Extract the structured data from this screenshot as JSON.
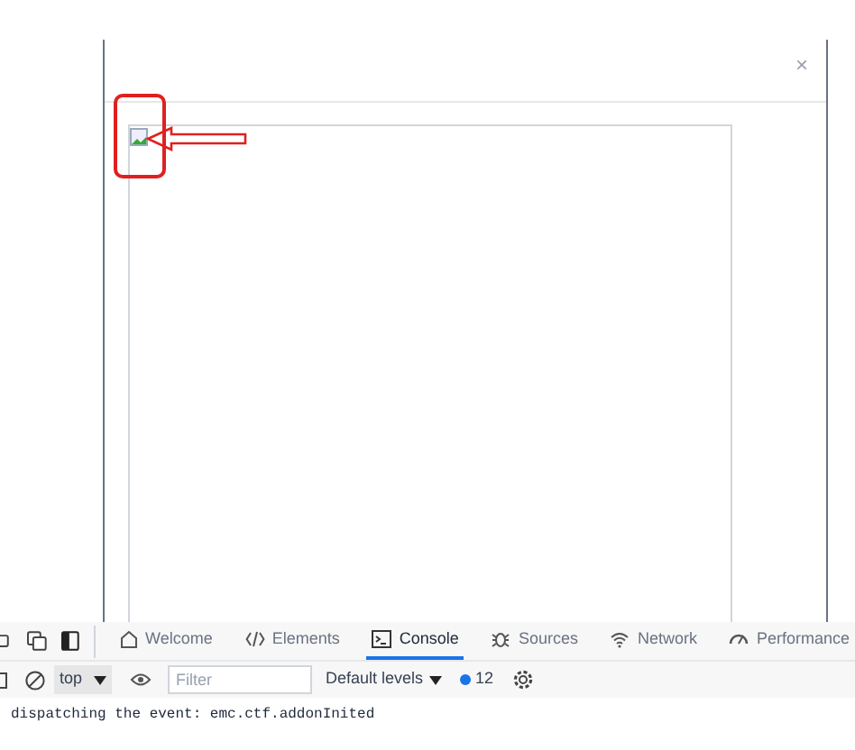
{
  "dialog": {
    "close": "×"
  },
  "devtools": {
    "tabs": [
      {
        "label": "Welcome",
        "selected": false
      },
      {
        "label": "Elements",
        "selected": false
      },
      {
        "label": "Console",
        "selected": true
      },
      {
        "label": "Sources",
        "selected": false
      },
      {
        "label": "Network",
        "selected": false
      },
      {
        "label": "Performance",
        "selected": false
      }
    ],
    "toolbar": {
      "context": "top",
      "filter": {
        "placeholder": "Filter"
      },
      "levels": "Default levels",
      "issues": "12"
    },
    "console": [
      "dispatching the event: emc.ctf.addonInited"
    ]
  }
}
